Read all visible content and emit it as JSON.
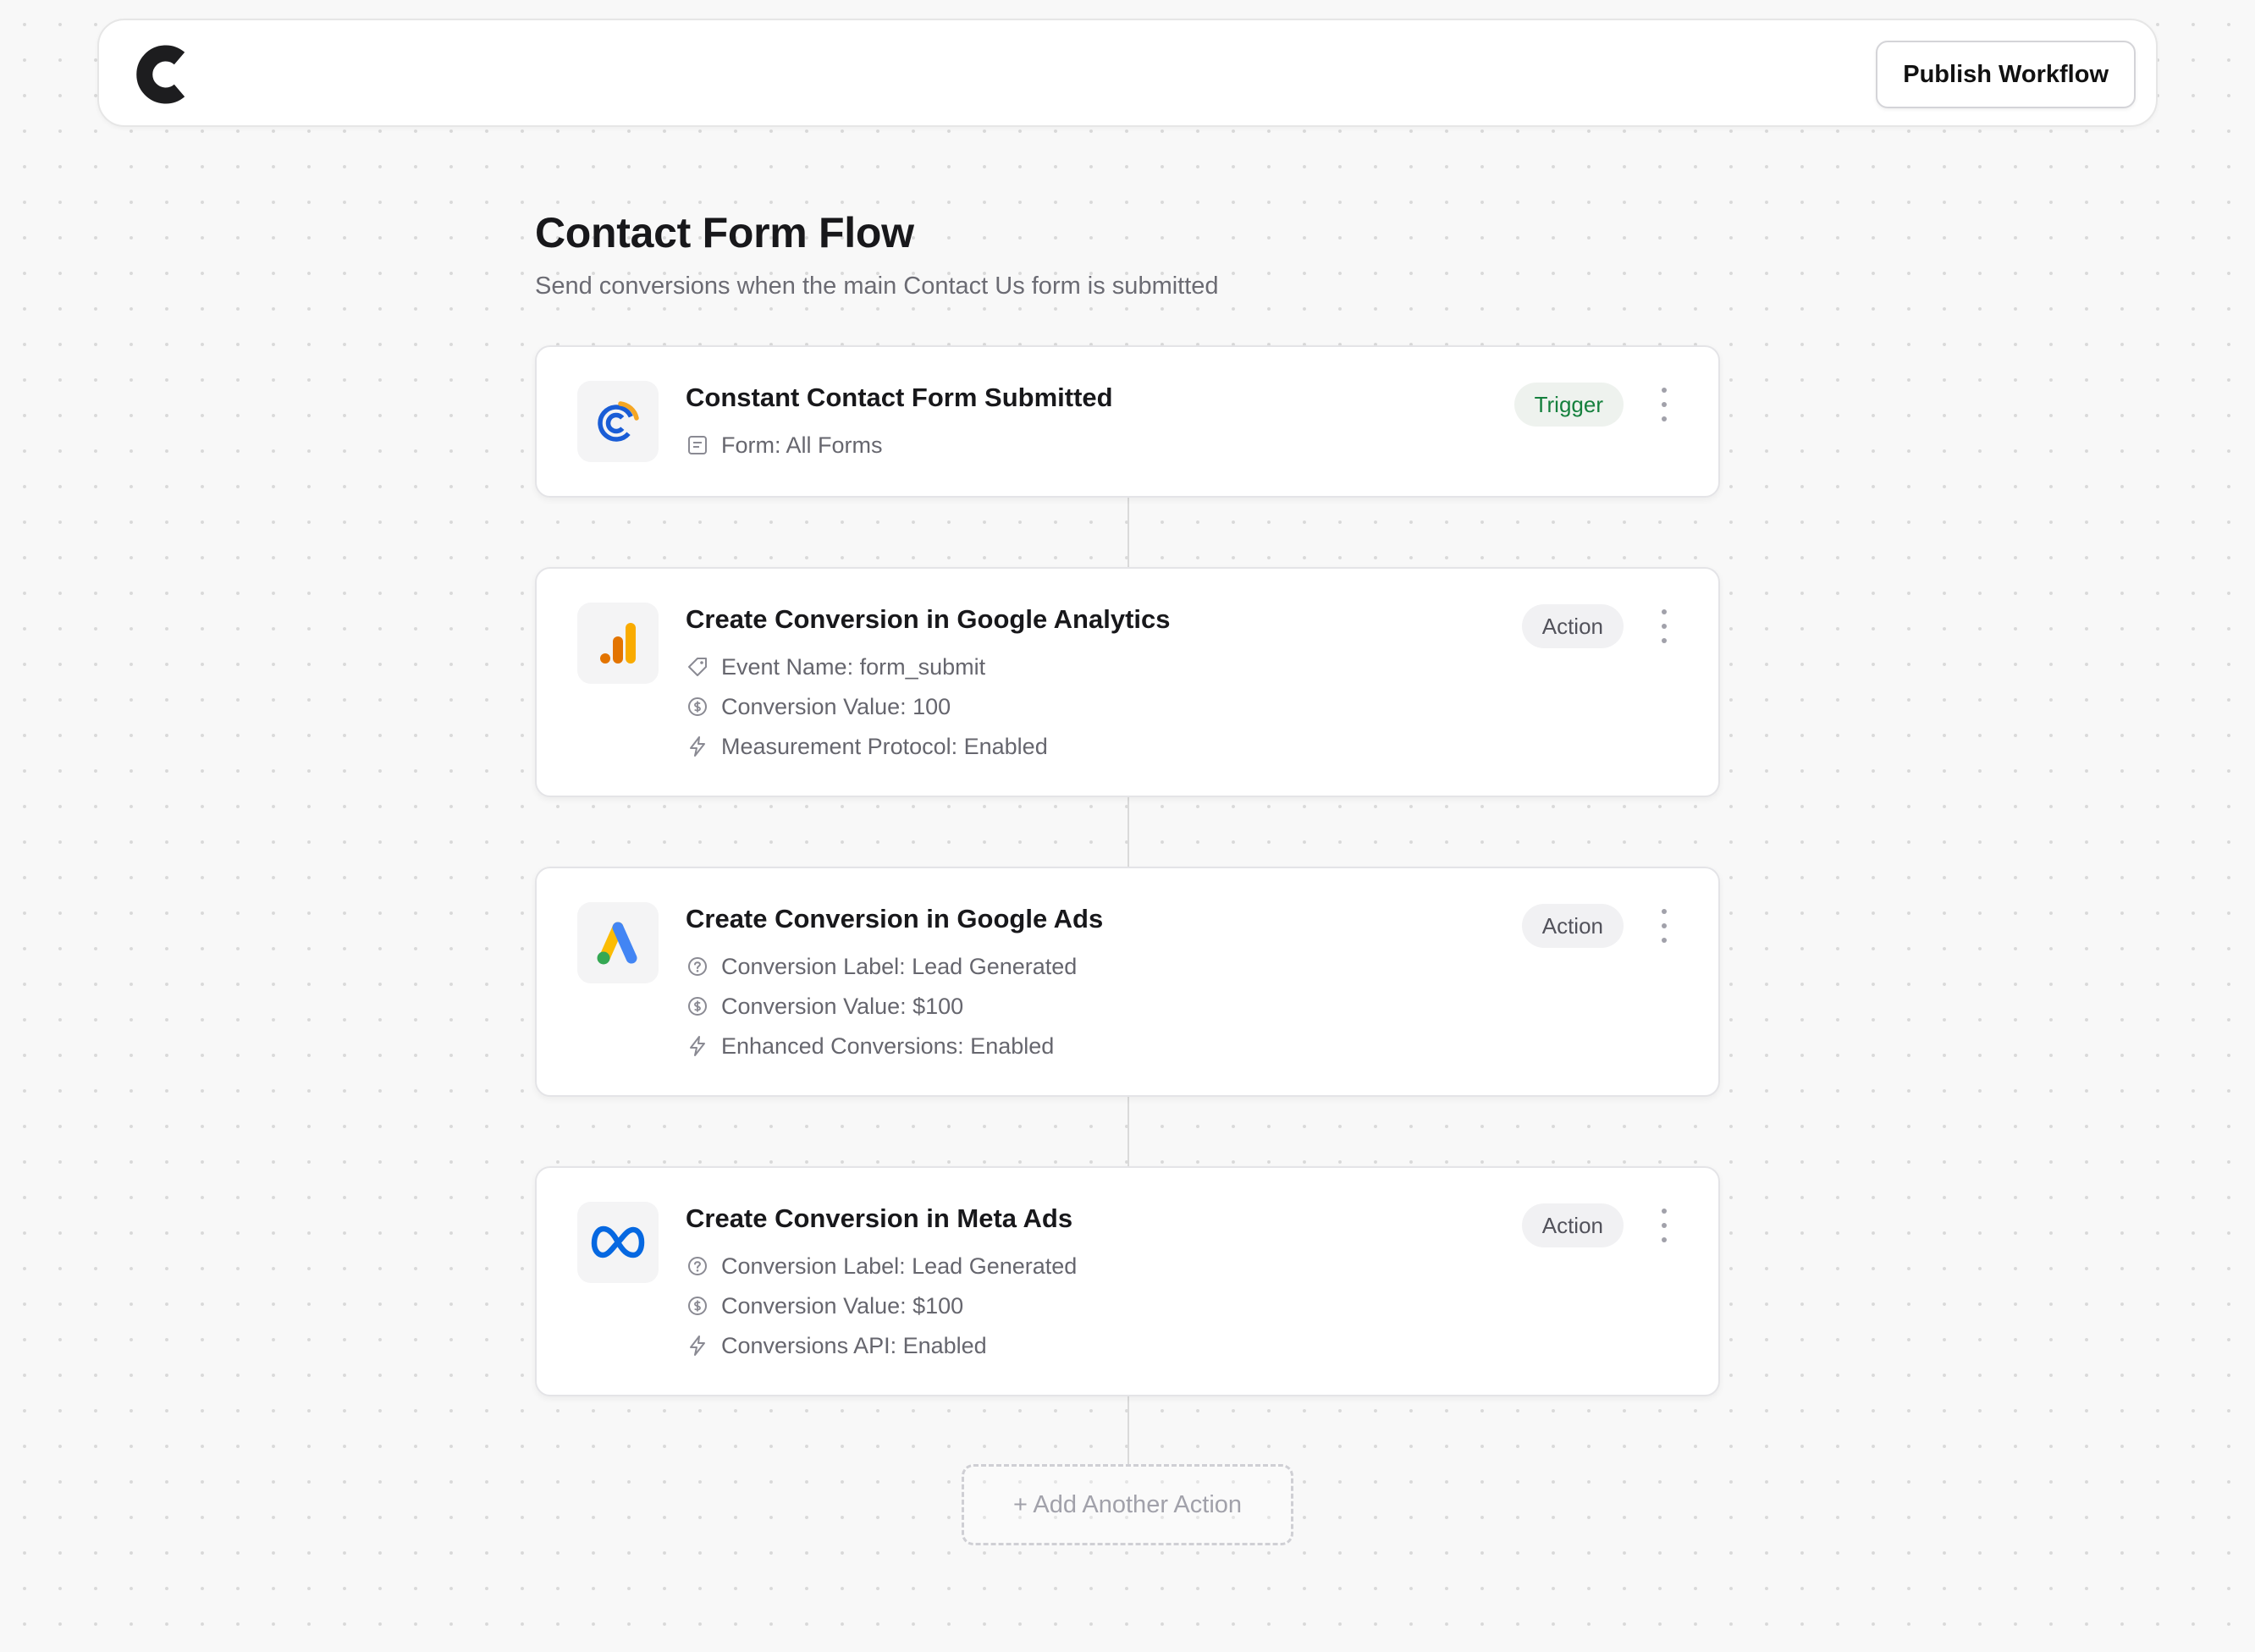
{
  "colors": {
    "accent_green": "#15803d",
    "background": "#f8f8f8",
    "card_border": "#e4e4e7"
  },
  "header": {
    "logo_icon": "c-logo-icon",
    "publish_label": "Publish Workflow"
  },
  "workflow": {
    "title": "Contact Form Flow",
    "subtitle": "Send conversions when the main Contact Us form is submitted"
  },
  "steps": [
    {
      "title": "Constant Contact Form Submitted",
      "badge": "Trigger",
      "icon": "constant-contact-icon",
      "details": [
        {
          "icon": "form-icon",
          "text": "Form: All Forms"
        }
      ]
    },
    {
      "title": "Create Conversion in Google Analytics",
      "badge": "Action",
      "icon": "google-analytics-icon",
      "details": [
        {
          "icon": "tag-icon",
          "text": "Event Name: form_submit"
        },
        {
          "icon": "dollar-icon",
          "text": "Conversion Value: 100"
        },
        {
          "icon": "bolt-icon",
          "text": "Measurement Protocol: Enabled"
        }
      ]
    },
    {
      "title": "Create Conversion in Google Ads",
      "badge": "Action",
      "icon": "google-ads-icon",
      "details": [
        {
          "icon": "help-circle-icon",
          "text": "Conversion Label: Lead Generated"
        },
        {
          "icon": "dollar-icon",
          "text": "Conversion Value: $100"
        },
        {
          "icon": "bolt-icon",
          "text": "Enhanced Conversions: Enabled"
        }
      ]
    },
    {
      "title": "Create Conversion in Meta Ads",
      "badge": "Action",
      "icon": "meta-icon",
      "details": [
        {
          "icon": "help-circle-icon",
          "text": "Conversion Label: Lead Generated"
        },
        {
          "icon": "dollar-icon",
          "text": "Conversion Value: $100"
        },
        {
          "icon": "bolt-icon",
          "text": "Conversions API: Enabled"
        }
      ]
    }
  ],
  "add_action_label": "+ Add Another Action"
}
